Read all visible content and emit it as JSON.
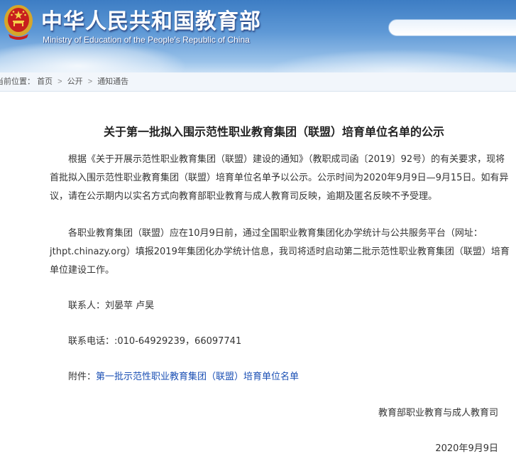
{
  "header": {
    "site_name_cn": "中华人民共和国教育部",
    "site_name_en": "Ministry of Education of the People's Republic of China",
    "search_placeholder": ""
  },
  "breadcrumb": {
    "prefix": "当前位置：",
    "items": [
      "首页",
      "公开",
      "通知通告"
    ],
    "separator": ">"
  },
  "article": {
    "title": "关于第一批拟入围示范性职业教育集团（联盟）培育单位名单的公示",
    "para1_lines": [
      "根据《关于开展示范性职业教育集团（联盟）建设的通知》（教职成司函〔2019〕92号）的有关要求，现将",
      "首批拟入围示范性职业教育集团（联盟）培育单位名单予以公示。公示时间为2020年9月9日—9月15日。如有异",
      "议，请在公示期内以实名方式向教育部职业教育与成人教育司反映，逾期及匿名反映不予受理。"
    ],
    "para2_lines": [
      "各职业教育集团（联盟）应在10月9日前，通过全国职业教育集团化办学统计与公共服务平台（网址：",
      "jthpt.chinazy.org）填报2019年集团化办学统计信息，我司将适时启动第二批示范性职业教育集团（联盟）培育",
      "单位建设工作。"
    ],
    "contact_people": "联系人：刘晏苹 卢昊",
    "contact_phone": "联系电话：:010-64929239，66097741",
    "attachment_label": "附件：",
    "attachment_link": "第一批示范性职业教育集团（联盟）培育单位名单",
    "signature": "教育部职业教育与成人教育司",
    "date": "2020年9月9日"
  },
  "colors": {
    "header_blue": "#3d7dc4",
    "link_blue": "#1a4fb4",
    "text": "#333333"
  }
}
